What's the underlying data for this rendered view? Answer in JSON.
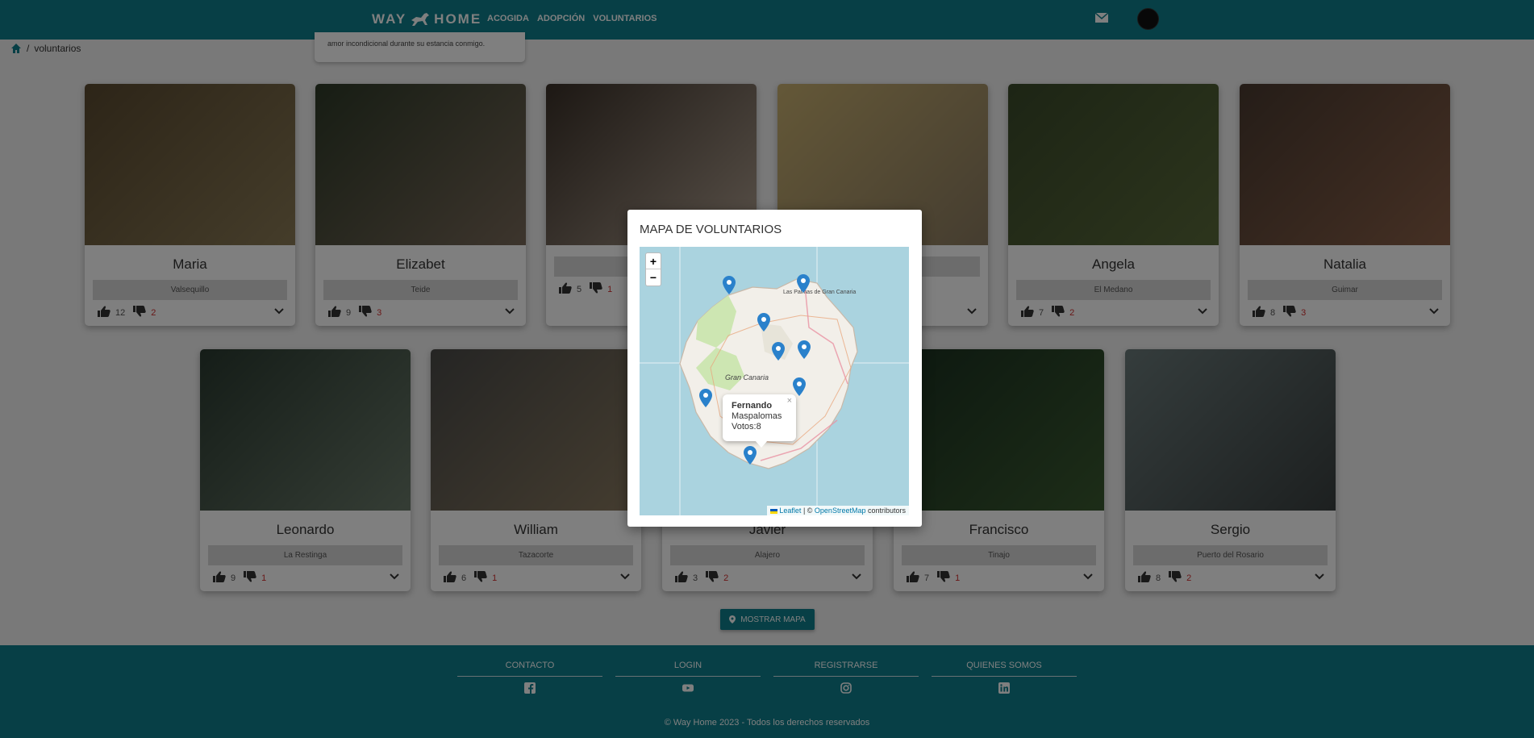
{
  "header": {
    "logo_left": "WAY",
    "logo_right": "HOME",
    "nav": [
      "ACOGIDA",
      "ADOPCIÓN",
      "VOLUNTARIOS"
    ],
    "brand_color": "#0e7f8c"
  },
  "breadcrumb": {
    "current": "voluntarios"
  },
  "tooltip_fragment": "amor incondicional durante su estancia conmigo.",
  "volunteers": [
    {
      "name": "Maria",
      "location": "Valsequillo",
      "up": "12",
      "down": "2"
    },
    {
      "name": "Elizabet",
      "location": "Teide",
      "up": "9",
      "down": "3"
    },
    {
      "name": "",
      "location": "",
      "up": "5",
      "down": "1"
    },
    {
      "name": "",
      "location": "",
      "up": "",
      "down": ""
    },
    {
      "name": "Angela",
      "location": "El Medano",
      "up": "7",
      "down": "2"
    },
    {
      "name": "Natalia",
      "location": "Guimar",
      "up": "8",
      "down": "3"
    },
    {
      "name": "Leonardo",
      "location": "La Restinga",
      "up": "9",
      "down": "1"
    },
    {
      "name": "William",
      "location": "Tazacorte",
      "up": "6",
      "down": "1"
    },
    {
      "name": "Javier",
      "location": "Alajero",
      "up": "3",
      "down": "2"
    },
    {
      "name": "Francisco",
      "location": "Tinajo",
      "up": "7",
      "down": "1"
    },
    {
      "name": "Sergio",
      "location": "Puerto del Rosario",
      "up": "8",
      "down": "2"
    }
  ],
  "map_button": "MOSTRAR MAPA",
  "modal": {
    "title": "MAPA DE VOLUNTARIOS",
    "zoom_in": "+",
    "zoom_out": "−",
    "map_labels": {
      "island": "Gran Canaria",
      "city": "Las Palmas de Gran Canaria"
    },
    "popup": {
      "name": "Fernando",
      "location": "Maspalomas",
      "votes": "Votos:8",
      "close": "×"
    },
    "attribution": {
      "leaflet": "Leaflet",
      "sep": " | © ",
      "osm": "OpenStreetMap",
      "suffix": " contributors"
    }
  },
  "footer": {
    "columns": [
      {
        "label": "CONTACTO",
        "icon": "facebook-icon"
      },
      {
        "label": "LOGIN",
        "icon": "youtube-icon"
      },
      {
        "label": "REGISTRARSE",
        "icon": "instagram-icon"
      },
      {
        "label": "QUIENES SOMOS",
        "icon": "linkedin-icon"
      }
    ],
    "copyright": "© Way Home 2023 - Todos los derechos reservados"
  }
}
